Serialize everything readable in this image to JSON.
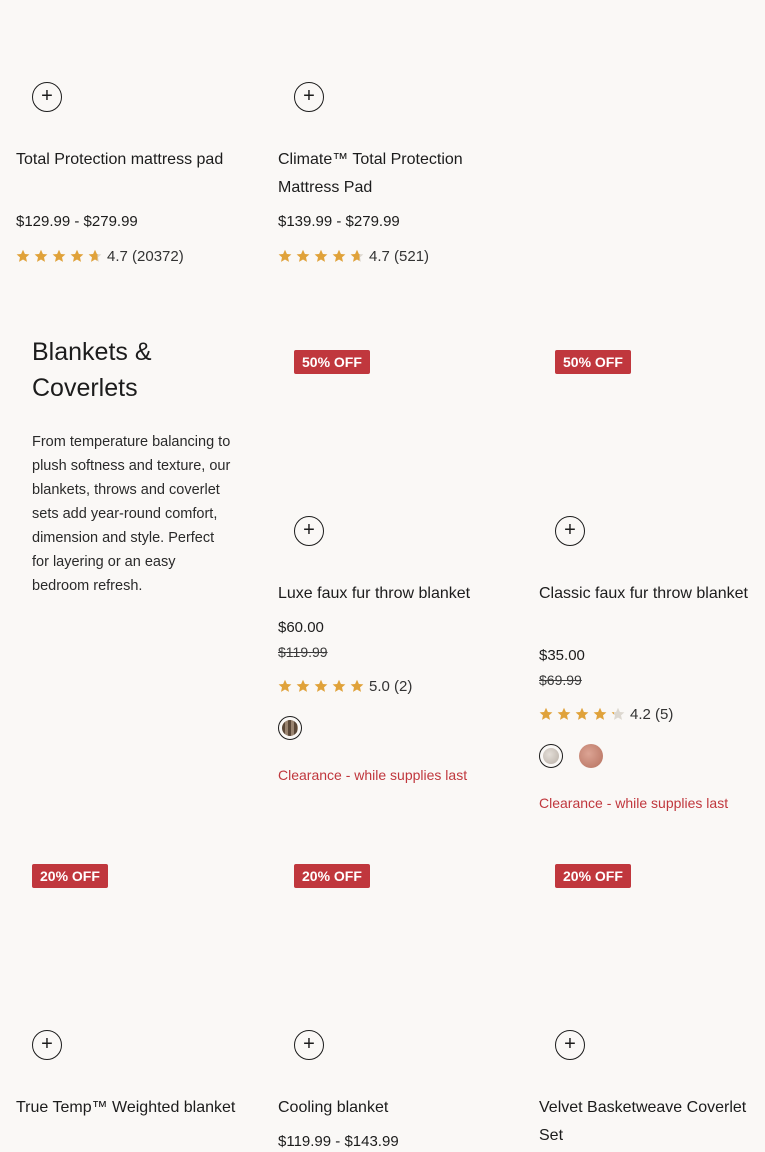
{
  "colors": {
    "star": "#e0a23a",
    "star_empty": "#ddd8d0",
    "badge_bg": "#c0373d",
    "clearance": "#c0373d"
  },
  "products_top": [
    {
      "title": "Total Protection mattress pad",
      "price": "$129.99 - $279.99",
      "rating": "4.7 (20372)",
      "rating_value": 4.7
    },
    {
      "title": "Climate™ Total Protection Mattress Pad",
      "price": "$139.99 - $279.99",
      "rating": "4.7 (521)",
      "rating_value": 4.7
    }
  ],
  "section": {
    "title": "Blankets & Coverlets",
    "description": "From temperature balancing to plush softness and texture, our blankets, throws and coverlet sets add year-round comfort, dimension and style. Perfect for layering or an easy bedroom refresh."
  },
  "products_mid": [
    {
      "badge": "50% OFF",
      "title": "Luxe faux fur throw blanket",
      "price": "$60.00",
      "old_price": "$119.99",
      "rating": "5.0 (2)",
      "rating_value": 5.0,
      "clearance": "Clearance - while supplies last",
      "swatches": [
        "#6e5a4a"
      ]
    },
    {
      "badge": "50% OFF",
      "title": "Classic faux fur throw blanket",
      "price": "$35.00",
      "old_price": "$69.99",
      "rating": "4.2 (5)",
      "rating_value": 4.2,
      "clearance": "Clearance - while supplies last",
      "swatches": [
        "#cfc8c0",
        "#c98a78"
      ]
    }
  ],
  "products_bottom": [
    {
      "badge": "20% OFF",
      "title": "True Temp™ Weighted blanket"
    },
    {
      "badge": "20% OFF",
      "title": "Cooling blanket",
      "price": "$119.99 - $143.99"
    },
    {
      "badge": "20% OFF",
      "title": "Velvet Basketweave Coverlet Set"
    }
  ],
  "add_button_symbol": "+"
}
